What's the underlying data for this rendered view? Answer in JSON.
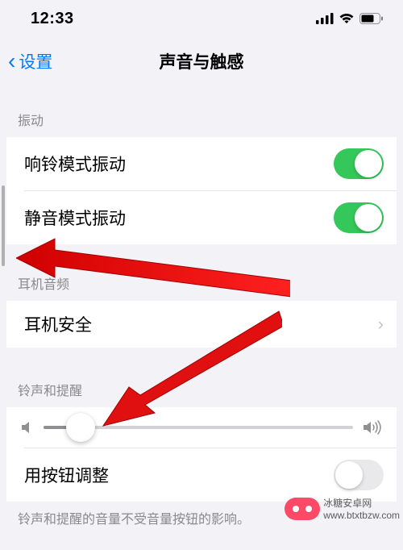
{
  "status": {
    "time": "12:33"
  },
  "nav": {
    "back_label": "设置",
    "title": "声音与触感"
  },
  "sections": {
    "vibration": {
      "header": "振动",
      "ring_vibrate": {
        "label": "响铃模式振动",
        "on": true
      },
      "silent_vibrate": {
        "label": "静音模式振动",
        "on": true
      }
    },
    "headphone": {
      "header": "耳机音频",
      "safety": {
        "label": "耳机安全"
      }
    },
    "ringer": {
      "header": "铃声和提醒",
      "volume_percent": 12,
      "change_with_buttons": {
        "label": "用按钮调整",
        "on": false
      },
      "footer": "铃声和提醒的音量不受音量按钮的影响。"
    }
  },
  "watermark": "冰糖安卓网\nwww.btxtbzw.com"
}
